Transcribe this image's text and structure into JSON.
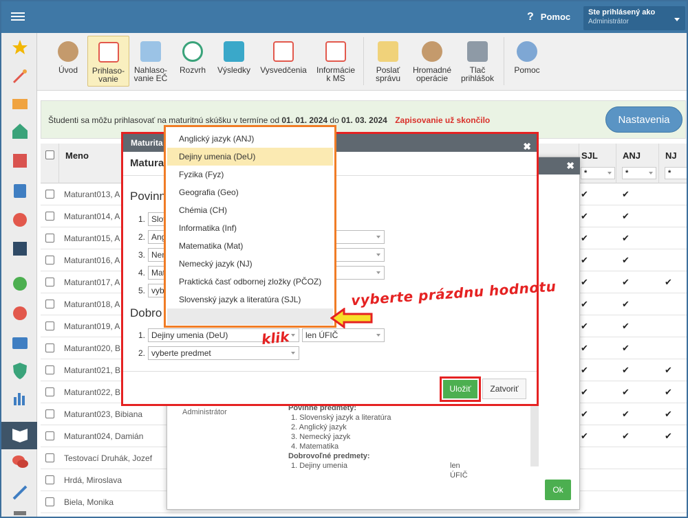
{
  "topbar": {
    "help_label": "Pomoc",
    "user_line1": "Ste prihlásený ako",
    "user_line2": "Administrátor"
  },
  "sidebar": {
    "icons": [
      "star-icon",
      "magic-wand-icon",
      "mail-icon",
      "home-icon",
      "calendar-grid-icon",
      "book-icon",
      "user-icon",
      "schedule-icon",
      "check-circle-icon",
      "pencil-circle-icon",
      "briefcase-icon",
      "shield-icon",
      "bar-chart-icon",
      "open-book-icon",
      "chat-icon",
      "pen-icon",
      "wrench-icon"
    ]
  },
  "toolbar": {
    "items": [
      {
        "l1": "Úvod",
        "l2": ""
      },
      {
        "l1": "Prihlaso-",
        "l2": "vanie"
      },
      {
        "l1": "Nahlaso-",
        "l2": "vanie EČ"
      },
      {
        "l1": "Rozvrh",
        "l2": ""
      },
      {
        "l1": "Výsledky",
        "l2": ""
      },
      {
        "l1": "Vysvedčenia",
        "l2": ""
      },
      {
        "l1": "Informácie",
        "l2": "k MS"
      },
      {
        "l1": "Poslať",
        "l2": "správu"
      },
      {
        "l1": "Hromadné",
        "l2": "operácie"
      },
      {
        "l1": "Tlač",
        "l2": "prihlášok"
      },
      {
        "l1": "Pomoc",
        "l2": ""
      }
    ]
  },
  "notice": {
    "text": "Študenti sa môžu prihlasovať na maturitnú skúšku v termíne od",
    "from": "01. 01. 2024",
    "mid": "do",
    "to": "01. 03. 2024",
    "closed": "Zapisovanie už skončilo",
    "settings_button": "Nastavenia"
  },
  "grid": {
    "headers": {
      "name": "Meno",
      "sjl": "SJL",
      "anj": "ANJ",
      "nj": "NJ"
    },
    "filter": "*",
    "rows": [
      {
        "name": "Maturant013, A"
      },
      {
        "name": "Maturant014, A"
      },
      {
        "name": "Maturant015, A"
      },
      {
        "name": "Maturant016, A"
      },
      {
        "name": "Maturant017, A"
      },
      {
        "name": "Maturant018, A"
      },
      {
        "name": "Maturant019, A"
      },
      {
        "name": "Maturant020, B"
      },
      {
        "name": "Maturant021, B"
      },
      {
        "name": "Maturant022, B"
      },
      {
        "name": "Maturant023, Bibiana"
      },
      {
        "name": "Maturant024, Damián"
      },
      {
        "name": "Testovací Druhák, Jozef"
      },
      {
        "name": "Hrdá, Miroslava"
      },
      {
        "name": "Biela, Monika"
      }
    ]
  },
  "back_dialog": {
    "admin": "Administrátor",
    "required_title": "Povinné predmety:",
    "required": [
      "1. Slovenský jazyk a literatúra",
      "2. Anglický jazyk",
      "3. Nemecký jazyk",
      "4. Matematika"
    ],
    "optional_title": "Dobrovoľné predmety:",
    "optional": [
      "1. Dejiny umenia"
    ],
    "optional_level": "len ÚFIČ",
    "ok": "Ok"
  },
  "dialog": {
    "title": "Maturita",
    "subtitle": "Matura",
    "section_required": "Povinn",
    "section_optional": "Dobro",
    "required": [
      {
        "n": "1.",
        "v": "Slov"
      },
      {
        "n": "2.",
        "v": "Ang"
      },
      {
        "n": "3.",
        "v": "Nem"
      },
      {
        "n": "4.",
        "v": "Mat"
      },
      {
        "n": "5.",
        "v": "vybe"
      }
    ],
    "optional": [
      {
        "n": "1.",
        "v": "Dejiny umenia (DeU)",
        "level": "len ÚFIČ"
      },
      {
        "n": "2.",
        "v": "vyberte predmet"
      }
    ],
    "save": "Uložiť",
    "close": "Zatvoriť"
  },
  "dropdown": {
    "options": [
      "Anglický jazyk (ANJ)",
      "Dejiny umenia (DeU)",
      "Fyzika (Fyz)",
      "Geografia (Geo)",
      "Chémia (CH)",
      "Informatika (Inf)",
      "Matematika (Mat)",
      "Nemecký jazyk (NJ)",
      "Praktická časť odbornej zložky (PČOZ)",
      "Slovenský jazyk a literatúra (SJL)"
    ],
    "selected_index": 1
  },
  "annotations": {
    "hint": "vyberte prázdnu hodnotu",
    "click": "klik"
  },
  "colors": {
    "topbar": "#3f78a6",
    "accent_red": "#e52222",
    "dropdown_border": "#f07c26",
    "save_green": "#4caf50"
  }
}
